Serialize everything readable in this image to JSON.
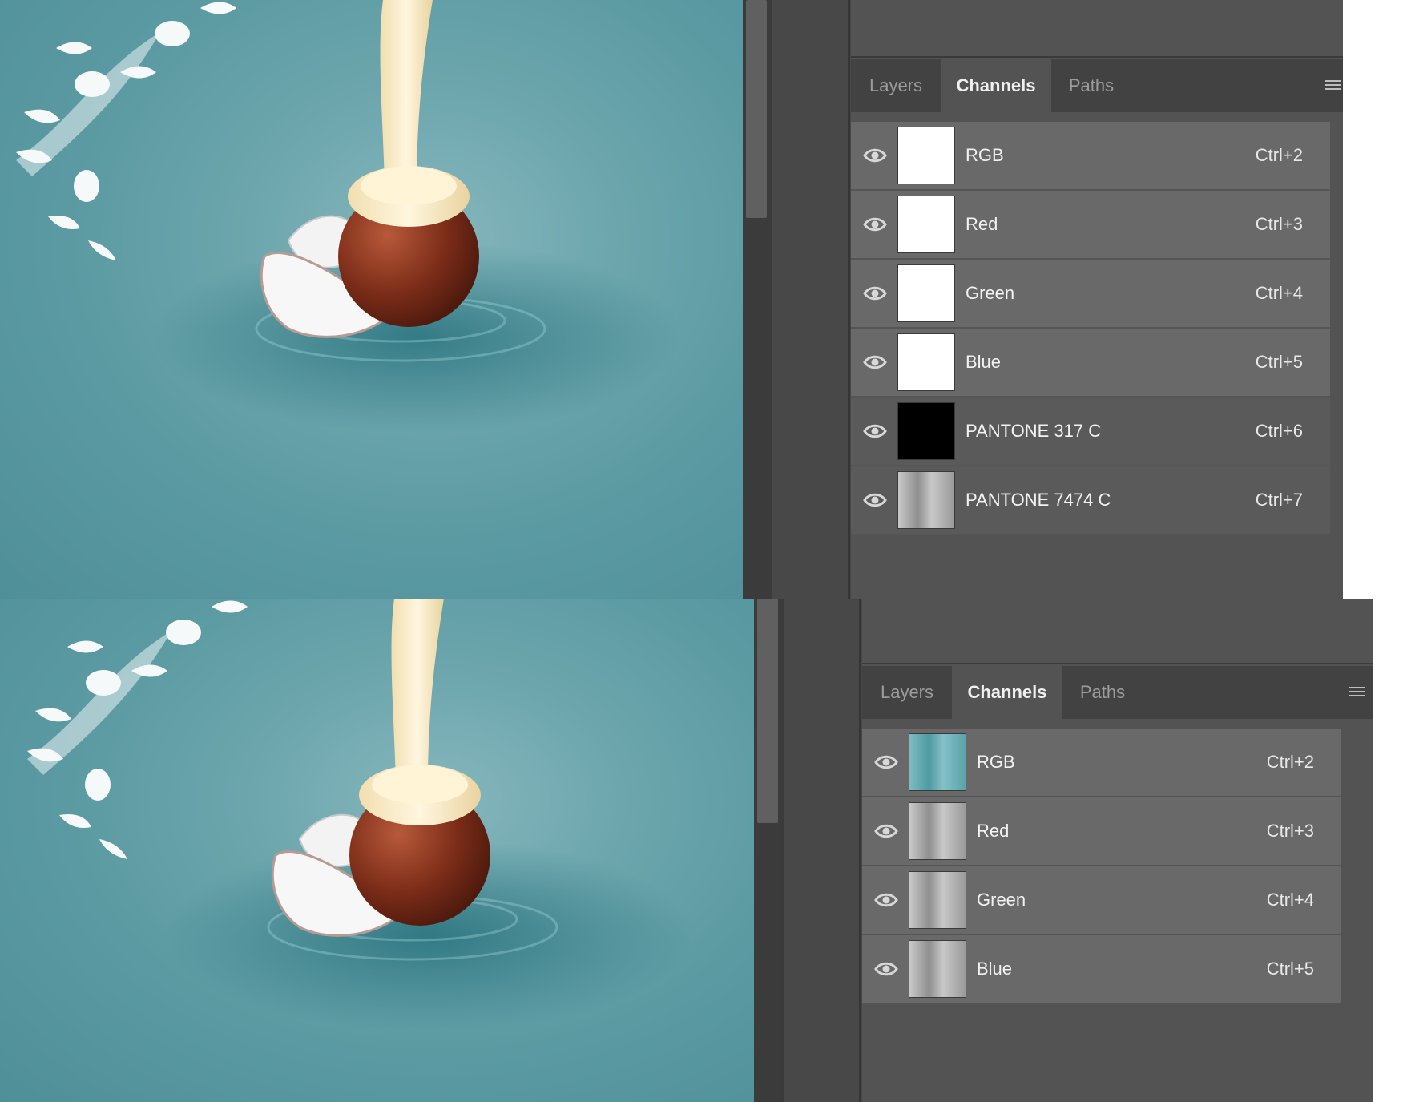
{
  "top_panel": {
    "tabs": [
      {
        "label": "Layers",
        "active": false
      },
      {
        "label": "Channels",
        "active": true
      },
      {
        "label": "Paths",
        "active": false
      }
    ],
    "channels": [
      {
        "name": "RGB",
        "shortcut": "Ctrl+2"
      },
      {
        "name": "Red",
        "shortcut": "Ctrl+3"
      },
      {
        "name": "Green",
        "shortcut": "Ctrl+4"
      },
      {
        "name": "Blue",
        "shortcut": "Ctrl+5"
      },
      {
        "name": "PANTONE 317 C",
        "shortcut": "Ctrl+6"
      },
      {
        "name": "PANTONE 7474 C",
        "shortcut": "Ctrl+7"
      }
    ]
  },
  "bottom_panel": {
    "tabs": [
      {
        "label": "Layers",
        "active": false
      },
      {
        "label": "Channels",
        "active": true
      },
      {
        "label": "Paths",
        "active": false
      }
    ],
    "channels": [
      {
        "name": "RGB",
        "shortcut": "Ctrl+2"
      },
      {
        "name": "Red",
        "shortcut": "Ctrl+3"
      },
      {
        "name": "Green",
        "shortcut": "Ctrl+4"
      },
      {
        "name": "Blue",
        "shortcut": "Ctrl+5"
      }
    ]
  },
  "icons": {
    "visibility": "eye-icon",
    "panel_menu": "panel-menu-icon"
  },
  "colors": {
    "canvas_teal": "#5b9aa2",
    "panel_bg": "#535353",
    "row_bg": "#696969",
    "tab_bar_bg": "#424242"
  }
}
